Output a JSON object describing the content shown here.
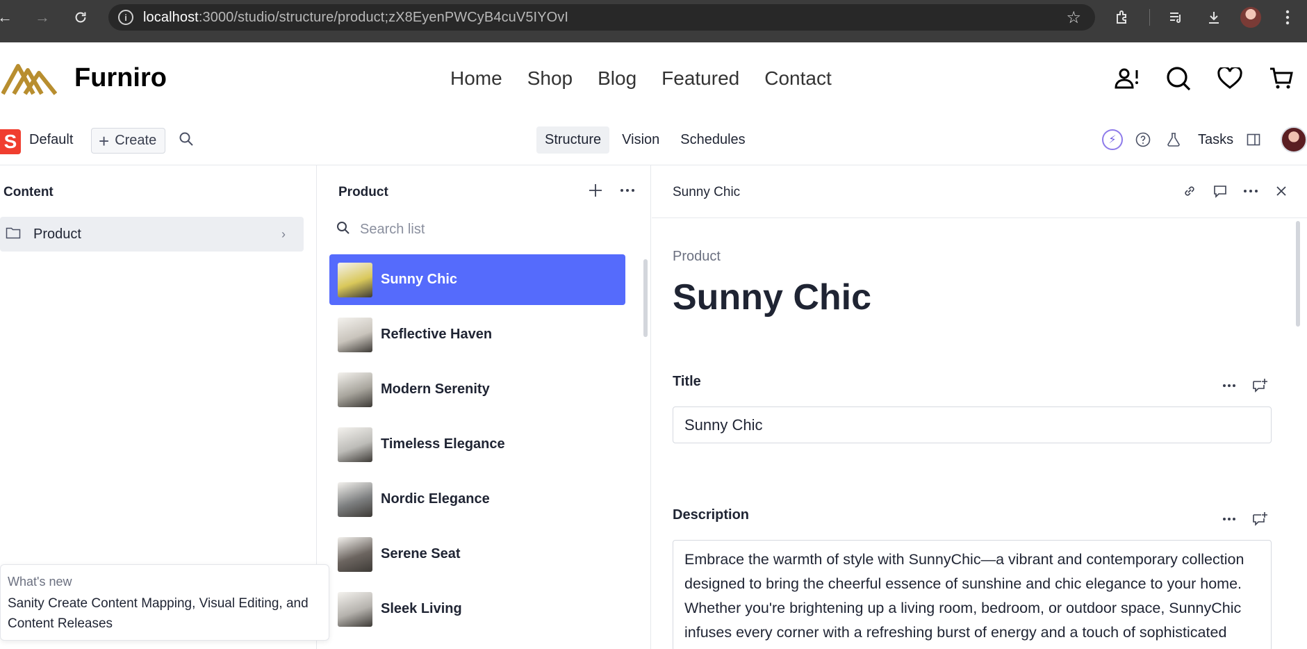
{
  "browser": {
    "url_host": "localhost",
    "url_rest": ":3000/studio/structure/product;zX8EyenPWCyB4cuV5IYOvI"
  },
  "site": {
    "brand": "Furniro",
    "nav": [
      "Home",
      "Shop",
      "Blog",
      "Featured",
      "Contact"
    ]
  },
  "studio": {
    "logo_letter": "S",
    "workspace": "Default",
    "create_label": "Create",
    "tabs": [
      "Structure",
      "Vision",
      "Schedules"
    ],
    "active_tab": "Structure",
    "tasks_label": "Tasks"
  },
  "content_pane": {
    "title": "Content",
    "items": [
      {
        "label": "Product"
      }
    ]
  },
  "whats_new": {
    "label": "What's new",
    "text": "Sanity Create Content Mapping, Visual Editing, and Content Releases"
  },
  "list_pane": {
    "title": "Product",
    "search_placeholder": "Search list",
    "docs": [
      {
        "name": "Sunny Chic",
        "selected": true,
        "thumb_color": "#d9c85a"
      },
      {
        "name": "Reflective Haven",
        "selected": false,
        "thumb_color": "#c9c4bc"
      },
      {
        "name": "Modern Serenity",
        "selected": false,
        "thumb_color": "#a8a59d"
      },
      {
        "name": "Timeless Elegance",
        "selected": false,
        "thumb_color": "#bdbcb8"
      },
      {
        "name": "Nordic Elegance",
        "selected": false,
        "thumb_color": "#7d7f80"
      },
      {
        "name": "Serene Seat",
        "selected": false,
        "thumb_color": "#6c6560"
      },
      {
        "name": "Sleek Living",
        "selected": false,
        "thumb_color": "#b5b2ad"
      }
    ]
  },
  "doc_pane": {
    "header_title": "Sunny Chic",
    "type_label": "Product",
    "title": "Sunny Chic",
    "fields": {
      "title": {
        "label": "Title",
        "value": "Sunny Chic"
      },
      "description": {
        "label": "Description",
        "value": "Embrace the warmth of style with SunnyChic—a vibrant and contemporary collection designed to bring the cheerful essence of sunshine and chic elegance to your home. Whether you're brightening up a living room, bedroom, or outdoor space, SunnyChic infuses every corner with a refreshing burst of energy and a touch of sophisticated charm."
      }
    }
  },
  "colors": {
    "accent": "#556bfc",
    "sanity_red": "#f03e2f",
    "brand_gold": "#b88e2f"
  }
}
